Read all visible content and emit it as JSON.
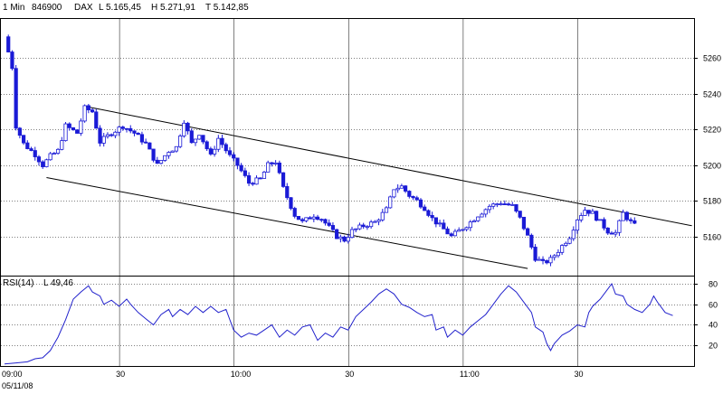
{
  "header": {
    "interval": "1 Min",
    "id": "846900",
    "name": "DAX",
    "low": "L  5.165,45",
    "high": "H  5.271,91",
    "last": "T  5.142,85"
  },
  "rsi_header": {
    "name": "RSI(14)",
    "last": "L  49,46"
  },
  "x_axis": {
    "ticks": [
      "09:00",
      "30",
      "10:00",
      "30",
      "11:00",
      "30"
    ],
    "date": "05/11/08"
  },
  "colors": {
    "up": "#ffffff",
    "down": "#1a1ad6",
    "rsi_line": "#2222cc",
    "grid": "#000000",
    "trend": "#000000"
  },
  "chart_data": [
    {
      "type": "candlestick",
      "title": "DAX 1 Min",
      "x_domain": [
        "09:00",
        "12:00"
      ],
      "y_ticks": [
        5160,
        5180,
        5200,
        5220,
        5240,
        5260
      ],
      "ylim": [
        5138,
        5282
      ],
      "grid": "vertical at half-hours, horizontal at price ticks",
      "anchors": [
        {
          "t": 0,
          "p": 5272
        },
        {
          "t": 2,
          "p": 5255
        },
        {
          "t": 3,
          "p": 5222
        },
        {
          "t": 5,
          "p": 5212
        },
        {
          "t": 8,
          "p": 5206
        },
        {
          "t": 10,
          "p": 5200
        },
        {
          "t": 12,
          "p": 5205
        },
        {
          "t": 14,
          "p": 5208
        },
        {
          "t": 16,
          "p": 5222
        },
        {
          "t": 19,
          "p": 5218
        },
        {
          "t": 21,
          "p": 5232
        },
        {
          "t": 23,
          "p": 5230
        },
        {
          "t": 25,
          "p": 5213
        },
        {
          "t": 28,
          "p": 5218
        },
        {
          "t": 31,
          "p": 5222
        },
        {
          "t": 34,
          "p": 5218
        },
        {
          "t": 37,
          "p": 5212
        },
        {
          "t": 40,
          "p": 5200
        },
        {
          "t": 43,
          "p": 5208
        },
        {
          "t": 45,
          "p": 5210
        },
        {
          "t": 47,
          "p": 5225
        },
        {
          "t": 49,
          "p": 5212
        },
        {
          "t": 51,
          "p": 5218
        },
        {
          "t": 54,
          "p": 5205
        },
        {
          "t": 56,
          "p": 5215
        },
        {
          "t": 59,
          "p": 5205
        },
        {
          "t": 61,
          "p": 5200
        },
        {
          "t": 64,
          "p": 5190
        },
        {
          "t": 67,
          "p": 5192
        },
        {
          "t": 69,
          "p": 5200
        },
        {
          "t": 71,
          "p": 5202
        },
        {
          "t": 73,
          "p": 5187
        },
        {
          "t": 76,
          "p": 5172
        },
        {
          "t": 78,
          "p": 5168
        },
        {
          "t": 81,
          "p": 5172
        },
        {
          "t": 83,
          "p": 5170
        },
        {
          "t": 85,
          "p": 5165
        },
        {
          "t": 87,
          "p": 5160
        },
        {
          "t": 89,
          "p": 5158
        },
        {
          "t": 91,
          "p": 5163
        },
        {
          "t": 94,
          "p": 5166
        },
        {
          "t": 97,
          "p": 5168
        },
        {
          "t": 100,
          "p": 5175
        },
        {
          "t": 102,
          "p": 5187
        },
        {
          "t": 104,
          "p": 5188
        },
        {
          "t": 106,
          "p": 5183
        },
        {
          "t": 108,
          "p": 5180
        },
        {
          "t": 110,
          "p": 5176
        },
        {
          "t": 112,
          "p": 5170
        },
        {
          "t": 114,
          "p": 5166
        },
        {
          "t": 117,
          "p": 5160
        },
        {
          "t": 119,
          "p": 5163
        },
        {
          "t": 122,
          "p": 5168
        },
        {
          "t": 124,
          "p": 5172
        },
        {
          "t": 127,
          "p": 5177
        },
        {
          "t": 130,
          "p": 5179
        },
        {
          "t": 133,
          "p": 5177
        },
        {
          "t": 135,
          "p": 5170
        },
        {
          "t": 137,
          "p": 5160
        },
        {
          "t": 139,
          "p": 5148
        },
        {
          "t": 141,
          "p": 5145
        },
        {
          "t": 143,
          "p": 5147
        },
        {
          "t": 145,
          "p": 5152
        },
        {
          "t": 148,
          "p": 5160
        },
        {
          "t": 150,
          "p": 5170
        },
        {
          "t": 152,
          "p": 5175
        },
        {
          "t": 154,
          "p": 5173
        },
        {
          "t": 156,
          "p": 5168
        },
        {
          "t": 158,
          "p": 5163
        },
        {
          "t": 160,
          "p": 5162
        },
        {
          "t": 162,
          "p": 5173
        },
        {
          "t": 164,
          "p": 5168
        },
        {
          "t": 165,
          "p": 5166
        }
      ],
      "trend_lines": [
        {
          "from": {
            "t": 21,
            "p": 5233
          },
          "to": {
            "t": 180,
            "p": 5166
          }
        },
        {
          "from": {
            "t": 11,
            "p": 5193
          },
          "to": {
            "t": 137,
            "p": 5142
          }
        }
      ]
    },
    {
      "type": "line",
      "title": "RSI(14)",
      "y_ticks": [
        20,
        40,
        60,
        80
      ],
      "ylim": [
        0,
        87
      ],
      "points": [
        [
          0,
          2
        ],
        [
          3,
          3
        ],
        [
          6,
          4
        ],
        [
          8,
          7
        ],
        [
          10,
          8
        ],
        [
          12,
          15
        ],
        [
          14,
          28
        ],
        [
          16,
          45
        ],
        [
          18,
          65
        ],
        [
          20,
          72
        ],
        [
          22,
          78
        ],
        [
          23,
          72
        ],
        [
          25,
          68
        ],
        [
          26,
          60
        ],
        [
          28,
          64
        ],
        [
          30,
          58
        ],
        [
          32,
          65
        ],
        [
          33,
          60
        ],
        [
          35,
          52
        ],
        [
          37,
          46
        ],
        [
          39,
          40
        ],
        [
          41,
          50
        ],
        [
          43,
          55
        ],
        [
          44,
          48
        ],
        [
          46,
          55
        ],
        [
          48,
          50
        ],
        [
          50,
          58
        ],
        [
          52,
          52
        ],
        [
          54,
          58
        ],
        [
          56,
          52
        ],
        [
          58,
          55
        ],
        [
          60,
          35
        ],
        [
          62,
          28
        ],
        [
          64,
          32
        ],
        [
          66,
          30
        ],
        [
          68,
          35
        ],
        [
          70,
          40
        ],
        [
          72,
          28
        ],
        [
          74,
          35
        ],
        [
          76,
          30
        ],
        [
          78,
          38
        ],
        [
          80,
          40
        ],
        [
          82,
          25
        ],
        [
          84,
          32
        ],
        [
          86,
          28
        ],
        [
          88,
          38
        ],
        [
          90,
          35
        ],
        [
          92,
          48
        ],
        [
          94,
          55
        ],
        [
          96,
          62
        ],
        [
          98,
          70
        ],
        [
          100,
          75
        ],
        [
          102,
          70
        ],
        [
          104,
          60
        ],
        [
          106,
          57
        ],
        [
          108,
          52
        ],
        [
          110,
          48
        ],
        [
          112,
          50
        ],
        [
          113,
          35
        ],
        [
          115,
          38
        ],
        [
          116,
          28
        ],
        [
          118,
          35
        ],
        [
          120,
          30
        ],
        [
          122,
          38
        ],
        [
          124,
          44
        ],
        [
          126,
          50
        ],
        [
          128,
          60
        ],
        [
          130,
          70
        ],
        [
          132,
          78
        ],
        [
          134,
          72
        ],
        [
          136,
          62
        ],
        [
          138,
          52
        ],
        [
          139,
          38
        ],
        [
          141,
          33
        ],
        [
          142,
          22
        ],
        [
          143,
          15
        ],
        [
          144,
          22
        ],
        [
          146,
          30
        ],
        [
          148,
          34
        ],
        [
          150,
          40
        ],
        [
          152,
          38
        ],
        [
          153,
          52
        ],
        [
          154,
          58
        ],
        [
          156,
          65
        ],
        [
          158,
          75
        ],
        [
          159,
          80
        ],
        [
          160,
          70
        ],
        [
          162,
          68
        ],
        [
          163,
          60
        ],
        [
          165,
          55
        ],
        [
          167,
          52
        ],
        [
          169,
          60
        ],
        [
          170,
          68
        ],
        [
          171,
          62
        ],
        [
          173,
          52
        ],
        [
          175,
          49
        ]
      ]
    }
  ]
}
